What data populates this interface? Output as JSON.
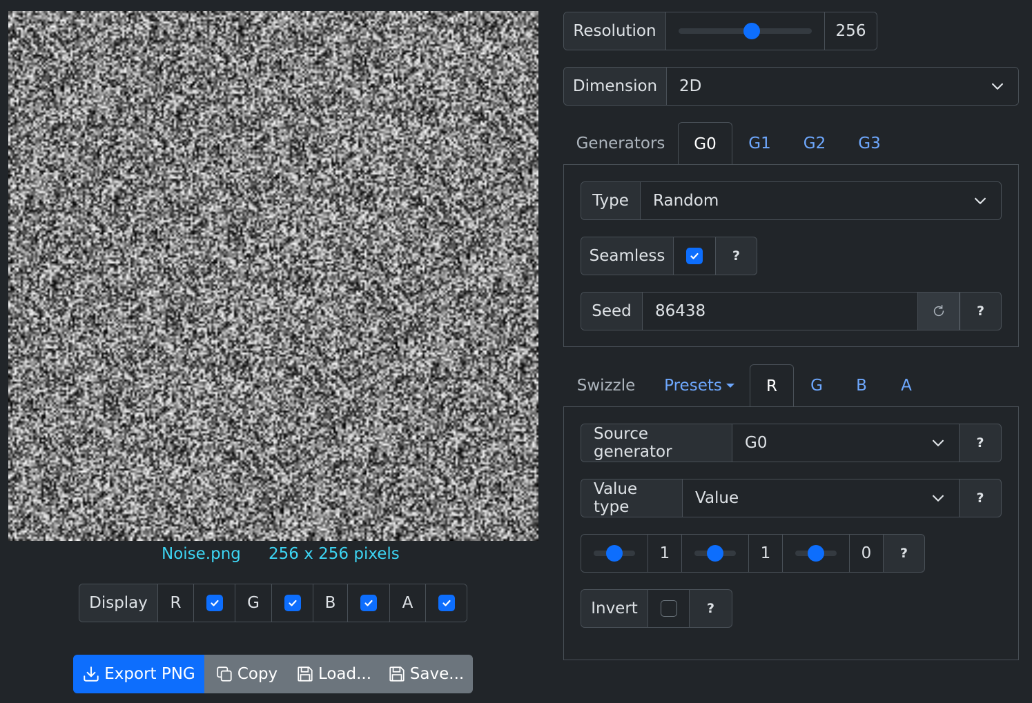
{
  "preview": {
    "filename": "Noise.png",
    "size_text": "256 x 256 pixels"
  },
  "display": {
    "label": "Display",
    "channels": [
      {
        "label": "R",
        "checked": true
      },
      {
        "label": "G",
        "checked": true
      },
      {
        "label": "B",
        "checked": true
      },
      {
        "label": "A",
        "checked": true
      }
    ]
  },
  "actions": {
    "export": "Export PNG",
    "copy": "Copy",
    "load": "Load...",
    "save": "Save..."
  },
  "resolution": {
    "label": "Resolution",
    "value": "256",
    "slider_fraction": 0.55
  },
  "dimension": {
    "label": "Dimension",
    "value": "2D"
  },
  "generators": {
    "heading": "Generators",
    "tabs": [
      "G0",
      "G1",
      "G2",
      "G3"
    ],
    "active": "G0",
    "type_label": "Type",
    "type_value": "Random",
    "seamless_label": "Seamless",
    "seamless_checked": true,
    "seed_label": "Seed",
    "seed_value": "86438",
    "help": "?"
  },
  "swizzle": {
    "heading": "Swizzle",
    "presets": "Presets",
    "tabs": [
      "R",
      "G",
      "B",
      "A"
    ],
    "active": "R",
    "source_label": "Source generator",
    "source_value": "G0",
    "value_type_label": "Value type",
    "value_type_value": "Value",
    "sliders": [
      {
        "value": "1",
        "fraction": 0.5
      },
      {
        "value": "1",
        "fraction": 0.5
      },
      {
        "value": "0",
        "fraction": 0.5
      }
    ],
    "invert_label": "Invert",
    "invert_checked": false,
    "help": "?"
  },
  "colors": {
    "background": "#212529",
    "accent": "#0d6efd",
    "link": "#6ea8fe",
    "caption": "#3dd5f3",
    "secondary": "#6c757d"
  }
}
